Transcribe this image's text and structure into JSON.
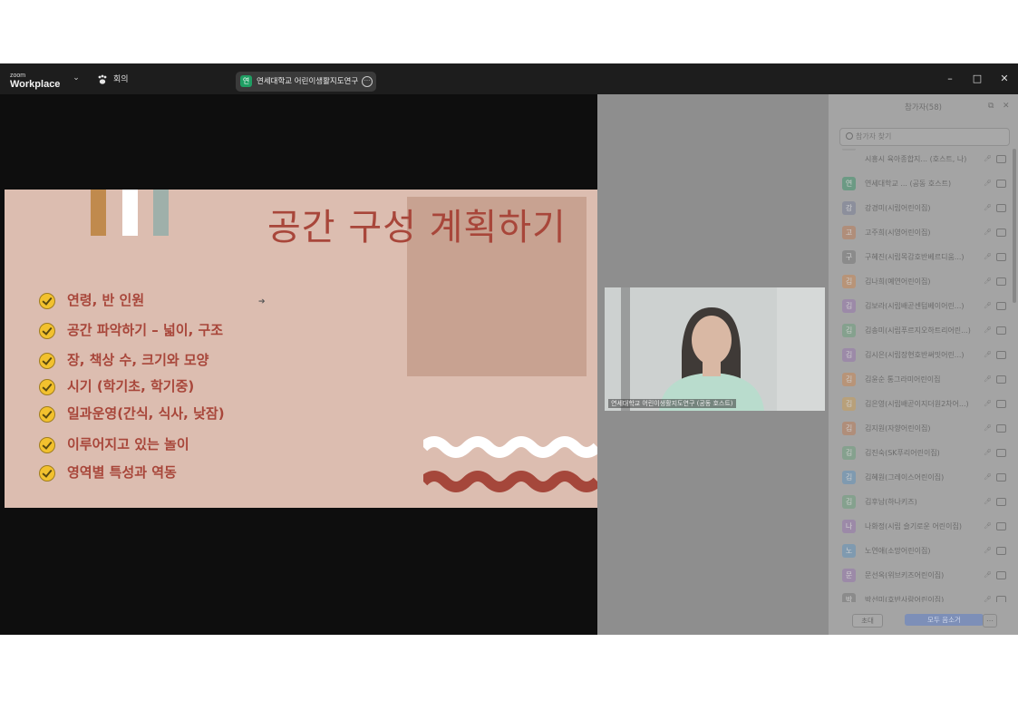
{
  "titlebar": {
    "logo_small": "zoom",
    "logo_big": "Workplace",
    "meeting_label": "회의",
    "meeting_pill_badge": "연",
    "meeting_pill_text": "연세대학교 어린이생활지도연구",
    "window_controls": {
      "minimize": "–",
      "maximize": "□",
      "close": "✕"
    }
  },
  "slide": {
    "title": "공간 구성 계획하기",
    "bullets": [
      "연령, 반 인원",
      "공간 파악하기 – 넓이, 구조",
      "장, 책상 수, 크기와 모양",
      "시기 (학기초, 학기중)",
      "일과운영(간식, 식사, 낮잠)",
      "이루어지고 있는 놀이",
      "영역별 특성과 역동"
    ],
    "colors": {
      "background": "#dcbdb0",
      "title": "#a8463a",
      "accent_box": "#c8a291",
      "bar1": "#c08a4d",
      "bar2": "#ffffff",
      "bar3": "#9fb0aa",
      "wave_white": "#ffffff",
      "wave_red": "#a5473b"
    }
  },
  "video": {
    "caption": "연세대학교 어린이생활지도연구 (공동 호스트)"
  },
  "panel": {
    "title": "참가자(58)",
    "search_placeholder": "참가자 찾기",
    "participants": [
      {
        "initial": "",
        "name": "시흥시 육아종합지... (호스트, 나)",
        "color": "#9a9a9a"
      },
      {
        "initial": "연",
        "name": "연세대학교 ... (공동 호스트)",
        "color": "#6c9a84"
      },
      {
        "initial": "강",
        "name": "강경미(시립어린이집)",
        "color": "#8c8f9c"
      },
      {
        "initial": "고",
        "name": "고주희(시영어린이집)",
        "color": "#b08e7a"
      },
      {
        "initial": "구",
        "name": "구혜진(시립목감호반베르디움...)",
        "color": "#8b8b8b"
      },
      {
        "initial": "김",
        "name": "김나희(예연어린이집)",
        "color": "#b89478"
      },
      {
        "initial": "김",
        "name": "김보라(시립배곧센텀베이어린...)",
        "color": "#9c8aa8"
      },
      {
        "initial": "김",
        "name": "김송미(시립푸르지오하트리어린...)",
        "color": "#85a18e"
      },
      {
        "initial": "김",
        "name": "김시은(시립장현호반써밋어린...)",
        "color": "#9c8aa8"
      },
      {
        "initial": "김",
        "name": "김윤순 통그라미어린이집",
        "color": "#b89478"
      },
      {
        "initial": "김",
        "name": "김은영(시립배곧이지더원2차어...)",
        "color": "#b8a07a"
      },
      {
        "initial": "김",
        "name": "김지원(자향어린이집)",
        "color": "#b08e7a"
      },
      {
        "initial": "김",
        "name": "김진숙(SK푸리어린이집)",
        "color": "#85a18e"
      },
      {
        "initial": "김",
        "name": "김혜원(그레이스어린이집)",
        "color": "#7f9ab0"
      },
      {
        "initial": "김",
        "name": "김후남(하나키즈)",
        "color": "#85a18e"
      },
      {
        "initial": "나",
        "name": "나화정(시립 슬기로운 어린이집)",
        "color": "#9c8aa8"
      },
      {
        "initial": "노",
        "name": "노연애(소망어린이집)",
        "color": "#7f9ab0"
      },
      {
        "initial": "문",
        "name": "문선옥(위브키즈어린이집)",
        "color": "#9c8aa8"
      },
      {
        "initial": "박",
        "name": "박선미(호반사랑어린이집)",
        "color": "#8b8b8b"
      }
    ],
    "buttons": {
      "invite": "초대",
      "mute_all": "모두 음소거",
      "more": "…"
    }
  }
}
